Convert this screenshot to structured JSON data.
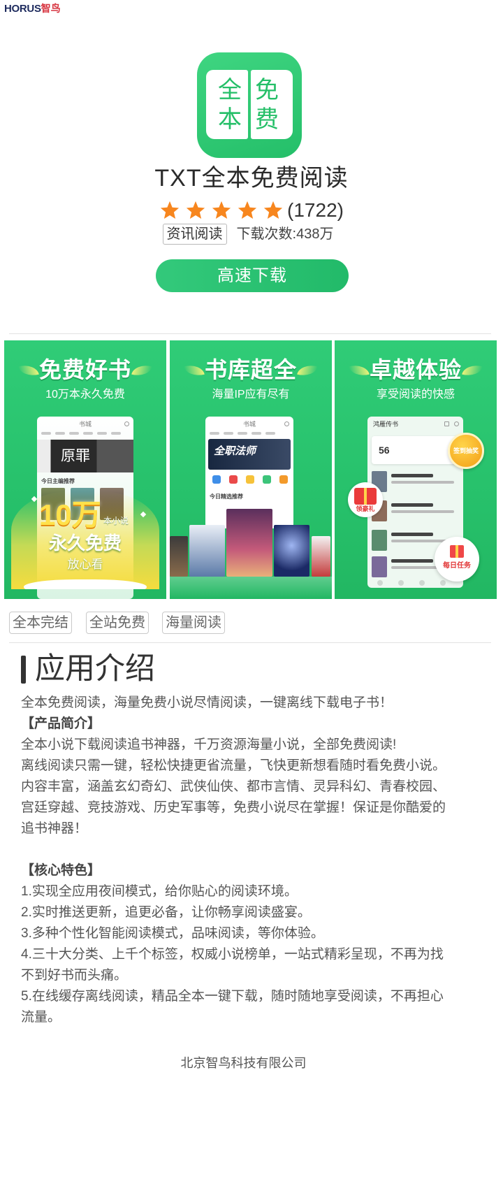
{
  "brand": {
    "latin": "HORUS",
    "cn": "智鸟"
  },
  "app": {
    "icon_chars": [
      "全",
      "免",
      "本",
      "费"
    ],
    "title": "TXT全本免费阅读",
    "rating": {
      "stars": 5,
      "count": "(1722)"
    },
    "category": "资讯阅读",
    "downloads": "下载次数:438万",
    "download_button": "高速下载"
  },
  "screenshots": [
    {
      "title": "免费好书",
      "subtitle": "10万本永久免费",
      "phone_header": "书城",
      "banner": "原罪",
      "section": "今日主编推荐",
      "promo": {
        "big": "10万",
        "small": "本小说",
        "main": "永久免费",
        "sub": "放心看"
      }
    },
    {
      "title": "书库超全",
      "subtitle": "海量IP应有尽有",
      "phone_header": "书城",
      "banner": "全职法师",
      "section": "今日精选推荐"
    },
    {
      "title": "卓越体验",
      "subtitle": "享受阅读的快感",
      "phone_header": "鸿雁传书",
      "points": "56",
      "checkin": "签到抽奖",
      "gift": "领豪礼",
      "task": "每日任务"
    }
  ],
  "tags": [
    "全本完结",
    "全站免费",
    "海量阅读"
  ],
  "intro": {
    "heading": "应用介绍",
    "lead": "全本免费阅读，海量免费小说尽情阅读，一键离线下载电子书！",
    "sections": [
      {
        "title": "【产品简介】",
        "lines": [
          "全本小说下载阅读追书神器，千万资源海量小说，全部免费阅读!",
          "离线阅读只需一键，轻松快捷更省流量，飞快更新想看随时看免费小说。",
          "内容丰富，涵盖玄幻奇幻、武侠仙侠、都市言情、灵异科幻、青春校园、",
          "宫廷穿越、竞技游戏、历史军事等，免费小说尽在掌握！保证是你酷爱的",
          "追书神器！"
        ]
      },
      {
        "title": "【核心特色】",
        "lines": [
          "1.实现全应用夜间模式，给你贴心的阅读环境。",
          "2.实时推送更新，追更必备，让你畅享阅读盛宴。",
          "3.多种个性化智能阅读模式，品味阅读，等你体验。",
          "4.三十大分类、上千个标签，权威小说榜单，一站式精彩呈现，不再为找",
          "不到好书而头痛。",
          "5.在线缓存离线阅读，精品全本一键下载，随时随地享受阅读，不再担心",
          "流量。"
        ]
      }
    ]
  },
  "footer": {
    "company": "北京智鸟科技有限公司"
  },
  "colors": {
    "brand_green": "#27c16b",
    "star_orange": "#f7861e",
    "logo_navy": "#1e2b5e",
    "logo_red": "#d7343f",
    "text": "#555555"
  }
}
